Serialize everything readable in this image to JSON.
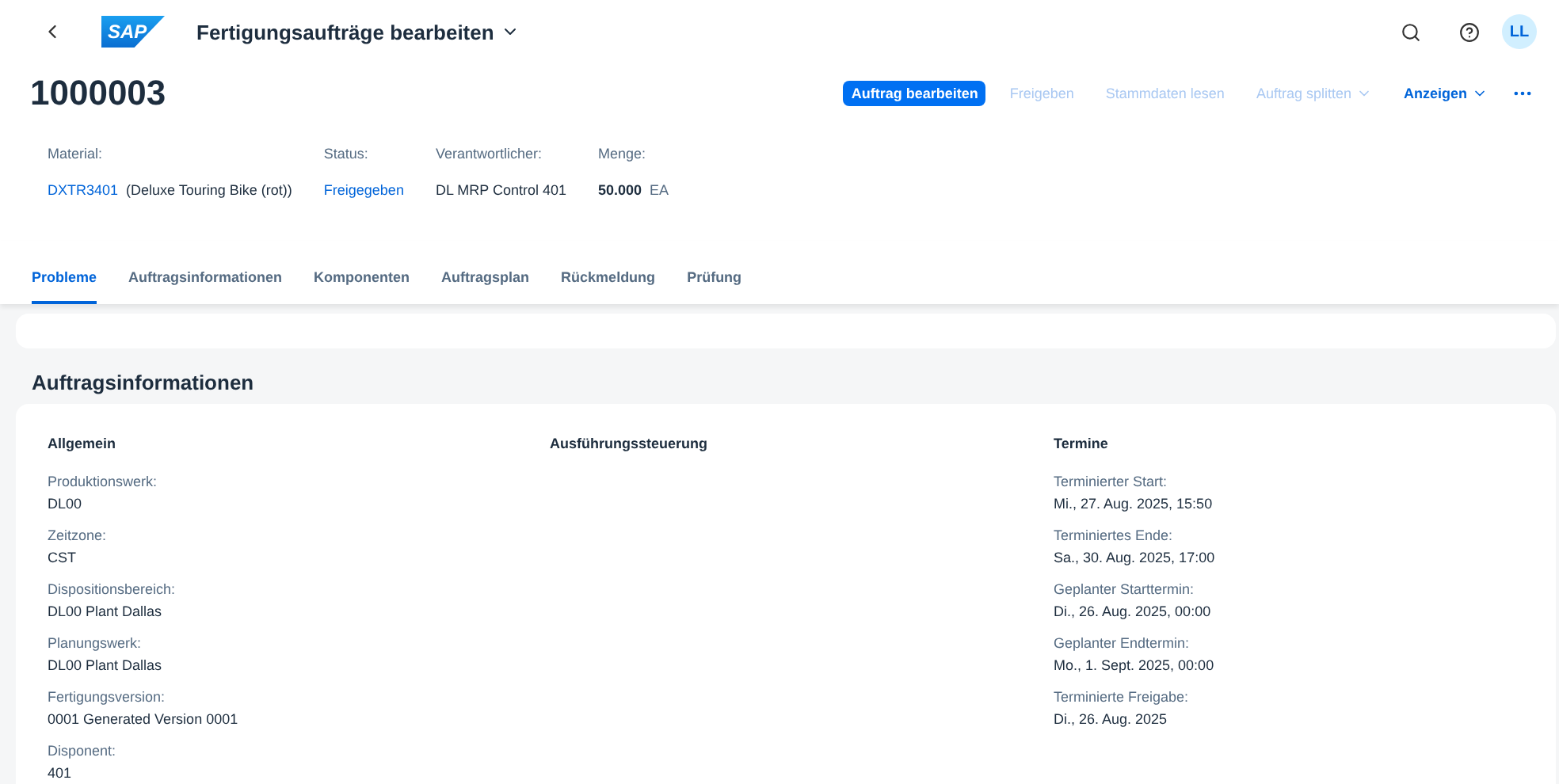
{
  "shell": {
    "logo": "SAP",
    "app_title": "Fertigungsaufträge bearbeiten",
    "avatar": "LL"
  },
  "header": {
    "title": "1000003",
    "actions": [
      {
        "label": "Auftrag bearbeiten",
        "kind": "primary",
        "disabled": false,
        "menu": false
      },
      {
        "label": "Freigeben",
        "kind": "text",
        "disabled": true,
        "menu": false
      },
      {
        "label": "Stammdaten lesen",
        "kind": "text",
        "disabled": true,
        "menu": false
      },
      {
        "label": "Auftrag splitten",
        "kind": "text",
        "disabled": true,
        "menu": true
      },
      {
        "label": "Anzeigen",
        "kind": "text",
        "disabled": false,
        "menu": true
      }
    ],
    "attributes": [
      {
        "label": "Material:",
        "kind": "link",
        "value": "DXTR3401",
        "extra": "(Deluxe Touring Bike (rot))"
      },
      {
        "label": "Status:",
        "kind": "link",
        "value": "Freigegeben"
      },
      {
        "label": "Verantwortlicher:",
        "kind": "plain",
        "value": "DL MRP Control 401"
      },
      {
        "label": "Menge:",
        "kind": "quantity",
        "value": "50.000",
        "extra": "EA"
      }
    ]
  },
  "tabs": [
    {
      "label": "Probleme",
      "selected": true
    },
    {
      "label": "Auftragsinformationen",
      "selected": false
    },
    {
      "label": "Komponenten",
      "selected": false
    },
    {
      "label": "Auftragsplan",
      "selected": false
    },
    {
      "label": "Rückmeldung",
      "selected": false
    },
    {
      "label": "Prüfung",
      "selected": false
    }
  ],
  "section": {
    "title": "Auftragsinformationen",
    "groups": [
      {
        "title": "Allgemein",
        "fields": [
          {
            "label": "Produktionswerk:",
            "value": "DL00"
          },
          {
            "label": "Zeitzone:",
            "value": "CST"
          },
          {
            "label": "Dispositionsbereich:",
            "value": "DL00 Plant Dallas"
          },
          {
            "label": "Planungswerk:",
            "value": "DL00 Plant Dallas"
          },
          {
            "label": "Fertigungsversion:",
            "value": "0001 Generated Version 0001"
          },
          {
            "label": "Disponent:",
            "value": "401"
          }
        ]
      },
      {
        "title": "Ausführungssteuerung"
      },
      {
        "title": "Termine",
        "fields": [
          {
            "label": "Terminierter Start:",
            "value": "Mi., 27. Aug. 2025, 15:50"
          },
          {
            "label": "Terminiertes Ende:",
            "value": "Sa., 30. Aug. 2025, 17:00"
          },
          {
            "label": "Geplanter Starttermin:",
            "value": "Di., 26. Aug. 2025, 00:00"
          },
          {
            "label": "Geplanter Endtermin:",
            "value": "Mo., 1. Sept. 2025, 00:00"
          },
          {
            "label": "Terminierte Freigabe:",
            "value": "Di., 26. Aug. 2025"
          }
        ]
      }
    ]
  }
}
